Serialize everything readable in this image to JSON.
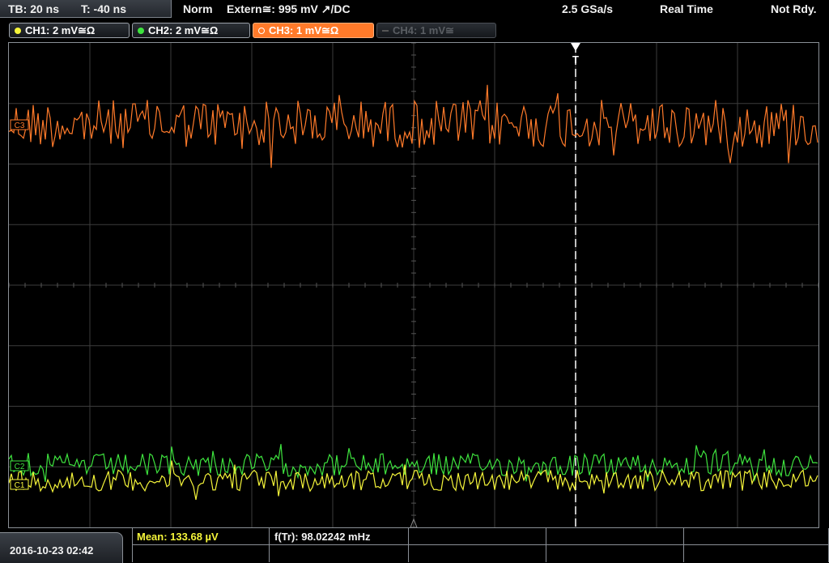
{
  "topbar": {
    "timebase": "TB: 20 ns",
    "trigger_time": "T: -40 ns",
    "mode": "Norm",
    "trigger_source": "Extern≅: 995 mV ↗/DC",
    "sample_rate": "2.5 GSa/s",
    "acquisition": "Real Time",
    "state": "Not Rdy."
  },
  "channels": [
    {
      "label": "CH1: 2 mV≅Ω",
      "color": "#f5f53a",
      "state": "on"
    },
    {
      "label": "CH2: 2 mV≅Ω",
      "color": "#3ee33e",
      "state": "on"
    },
    {
      "label": "CH3: 1 mV≅Ω",
      "color": "#ff7a2a",
      "state": "active"
    },
    {
      "label": "CH4: 1 mV≅",
      "color": "#555555",
      "state": "off"
    }
  ],
  "markers": {
    "trigger": "T",
    "ch3_ref": "C3",
    "ch2_ref": "C2",
    "ch1_ref": "C1"
  },
  "datetime": "2016-10-23 02:42",
  "measurements": {
    "mean": "Mean: 133.68 µV",
    "freq": "f(Tr): 98.02242 mHz"
  },
  "colors": {
    "ch1": "#f5f53a",
    "ch2": "#3ee33e",
    "ch3": "#ff7a2a",
    "grid": "#3c3c3c",
    "frame": "#8a8f96"
  }
}
